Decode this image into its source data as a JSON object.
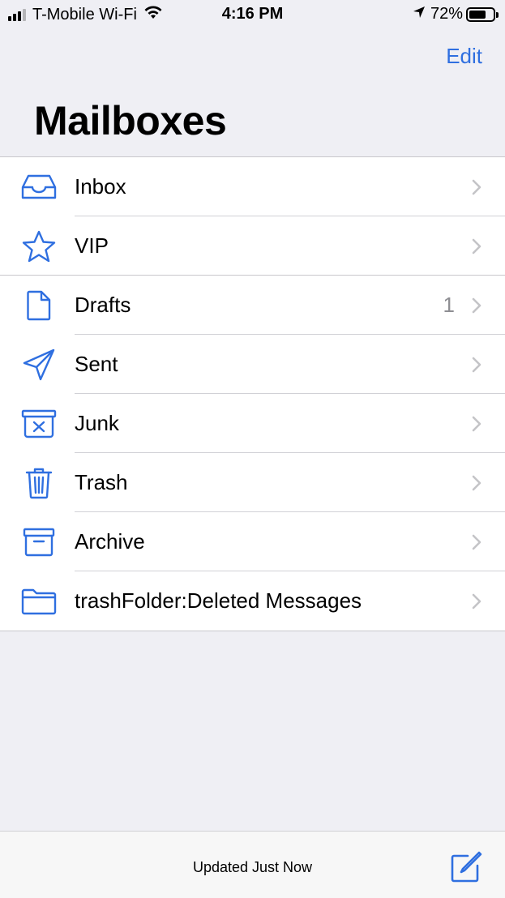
{
  "status_bar": {
    "carrier": "T-Mobile Wi-Fi",
    "time": "4:16 PM",
    "battery_percent": "72%",
    "battery_level": 0.72,
    "signal_bars_active": 3,
    "signal_bars_total": 4
  },
  "header": {
    "edit_label": "Edit",
    "title": "Mailboxes"
  },
  "mailboxes": [
    {
      "label": "Inbox",
      "icon": "inbox-tray-icon",
      "count": ""
    },
    {
      "label": "VIP",
      "icon": "star-icon",
      "count": ""
    },
    {
      "label": "Drafts",
      "icon": "document-icon",
      "count": "1"
    },
    {
      "label": "Sent",
      "icon": "paper-plane-icon",
      "count": ""
    },
    {
      "label": "Junk",
      "icon": "junk-bin-icon",
      "count": ""
    },
    {
      "label": "Trash",
      "icon": "trash-icon",
      "count": ""
    },
    {
      "label": "Archive",
      "icon": "archive-box-icon",
      "count": ""
    },
    {
      "label": "trashFolder:Deleted Messages",
      "icon": "folder-icon",
      "count": ""
    }
  ],
  "footer": {
    "status_text": "Updated Just Now",
    "compose_icon": "compose-icon"
  },
  "colors": {
    "accent": "#2f6fe0",
    "background": "#efeff4",
    "chevron": "#c4c4c7",
    "count": "#8e8e93"
  }
}
